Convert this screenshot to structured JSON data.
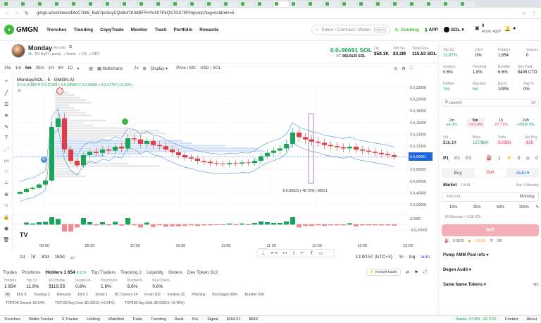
{
  "browser": {
    "tabs": [
      "",
      "",
      "",
      "",
      "",
      "",
      "",
      "",
      "",
      "",
      "",
      "",
      "",
      "",
      "",
      "",
      "",
      "",
      "",
      "",
      "",
      "",
      "",
      "",
      "",
      "",
      "",
      ""
    ],
    "url": "gmgn.ai/sol/token/DtoC7kb5_Ba97psSuyCQxBuf7K3dBFFHYvXhTPkQSTDS7RPmpump?tag=kol&min=5"
  },
  "app": {
    "brand": "GMGN",
    "nav": [
      "Trenches",
      "Trending",
      "CopyTrade",
      "Monitor",
      "Track",
      "Portfolio",
      "Rewards"
    ],
    "search_placeholder": "Token / Contract / Wallet",
    "search_kbd": "Ctrl+K",
    "cooking": "Cooking",
    "app_label": "APP",
    "chain": "SOL",
    "balance": "0",
    "wallet": "Acom..4gcP"
  },
  "token": {
    "name": "Monday",
    "alt_name": "Monday",
    "age": "4h",
    "ca_short": "DS Ba97...pump",
    "meta": [
      "Name",
      "CA",
      "DEV"
    ],
    "price": "0.0₂96691 SOL",
    "mc_label": "MC",
    "mc": "966.9125 SOL",
    "liq_label": "Liq",
    "liq": "$58.1K",
    "vol_label": "24h Vol",
    "vol": "$3.2M",
    "fees_label": "Total Fees",
    "fees": "115.63 SOL"
  },
  "chart_tools": {
    "intervals": [
      "15s",
      "1m",
      "5m",
      "30m",
      "1H",
      "4H",
      "1D"
    ],
    "multicharts": "Multicharts",
    "display": "Display",
    "price_mc": "Price / MC",
    "usd_sol": "USD / SOL"
  },
  "chart_data": {
    "type": "candlestick",
    "title": "Monday/SOL · 5 · GMGN.AI",
    "ohlc_line": "O 0.0₃91855  H 0.0₃97389  L 0.0₃89589  C 0.0₂96681 +0.0₃47767 (+5.20%)",
    "indicator_value": "6",
    "y_ticks": [
      "0.0₂22000",
      "0.0₂20000",
      "0.0₂18000",
      "0.0₂16000",
      "0.0₂14000",
      "0.0₂12000",
      "0.0₂10000",
      "0.0₃80000",
      "0.0₃60000",
      "0.0₃40000",
      "0.0₃20000",
      "0.0000",
      "-0.0₃20000"
    ],
    "x_ticks": [
      "09:00",
      "09:30",
      "10:00",
      "10:30",
      "11:00",
      "11:30",
      "12:00",
      "12:30",
      "13:00"
    ],
    "y_range": [
      -0.0002,
      0.0024
    ],
    "last_price_tag": "0.0₂96681",
    "measure_label": "-0.0₃89021 (-48.72%) -89021",
    "closes": [
      0.00035,
      0.0004,
      0.00042,
      0.00048,
      0.00055,
      0.0015,
      0.00165,
      0.0011,
      0.0009,
      0.00082,
      0.001,
      0.00106,
      0.00104,
      0.0011,
      0.00108,
      0.00115,
      0.00112,
      0.0013,
      0.00128,
      0.0012,
      0.00125,
      0.00118,
      0.00116,
      0.0011,
      0.00105,
      0.001,
      0.00096,
      0.00094,
      0.0009,
      0.00088,
      0.00086,
      0.00085,
      0.00084,
      0.00086,
      0.00085,
      0.00087,
      0.00086,
      0.0009,
      0.00098,
      0.00104,
      0.00108,
      0.00112,
      0.0012,
      0.0014,
      0.00132,
      0.00128,
      0.00124,
      0.00122,
      0.00118,
      0.00116,
      0.00114,
      0.00112,
      0.00115,
      0.0011,
      0.00108,
      0.00106,
      0.00104,
      0.00102,
      0.001,
      0.00097
    ]
  },
  "bottom_tools": {
    "ranges": [
      "1d",
      "7d",
      "30d",
      "180d"
    ],
    "time": "13:00:57 (UTC+3)",
    "pct": "%",
    "log": "log",
    "auto": "auto"
  },
  "bottom_panel": {
    "tabs": [
      "Trades",
      "Positions",
      "Holders 1 654",
      "Top Traders",
      "Tracking 2",
      "Liquidity",
      "Orders",
      "Dev Token 312"
    ],
    "holders_badge": "8.61%",
    "instant_trade": "Instant trade",
    "stats": [
      {
        "label": "Holders",
        "value": "1 654"
      },
      {
        "label": "Top 10",
        "value": "11.9%"
      },
      {
        "label": "MC/Holder",
        "value": "$119.55"
      },
      {
        "label": "Insiders%",
        "value": "0.8%"
      },
      {
        "label": "Phishing%",
        "value": "1.8%"
      },
      {
        "label": "Bundler%",
        "value": "6.6%"
      },
      {
        "label": "BlueChip%",
        "value": "0.8%"
      }
    ],
    "filters": [
      "All",
      "KOL 8",
      "Tracking 2",
      "Remarks",
      "DEV 1",
      "Smart 1",
      "BC Owners 24",
      "Fresh 302",
      "Insiders 16",
      "Phishing",
      "Bot Degen 999+",
      "Bundler 566"
    ],
    "footer": [
      "TOP100 Owned: 65.54%",
      "TOP100 Avg Cost: $0.00019 (+5.24%)",
      "TOP100 Avg Sold: $0.00019 (+5.45%)"
    ]
  },
  "right_panel": {
    "row1": [
      {
        "label": "Top 10",
        "value": "11.87%"
      },
      {
        "label": "DEV",
        "value": "0%"
      },
      {
        "label": "Holders",
        "value": "1,654"
      },
      {
        "label": "Snipers",
        "value": "0"
      }
    ],
    "row2": [
      {
        "label": "Insiders",
        "value": "0.6%"
      },
      {
        "label": "Phishing",
        "value": "1.8%"
      },
      {
        "label": "Bundler",
        "value": "6.6%"
      },
      {
        "label": "Dex Paid",
        "value": "$499 CTO"
      }
    ],
    "row3": [
      {
        "label": "NoMint",
        "value": "Yes"
      },
      {
        "label": "Blacklist",
        "value": "No"
      },
      {
        "label": "Burnt",
        "value": "100%"
      },
      {
        "label": "Rug %",
        "value": "0%"
      }
    ],
    "launch_label": "Launch",
    "launch_count": "13",
    "timeframes": [
      {
        "label": "1m",
        "value": "+4.3%"
      },
      {
        "label": "5m",
        "value": "-10.14%"
      },
      {
        "label": "1h",
        "value": "-27.71%"
      },
      {
        "label": "24h",
        "value": "+3908.5%"
      }
    ],
    "vol": [
      {
        "label": "Vol",
        "value": "$16.1K"
      },
      {
        "label": "Buys",
        "value": "127/$8K"
      },
      {
        "label": "Sells",
        "value": "95/$8K"
      },
      {
        "label": "Net Buy",
        "value": "-$2K"
      }
    ],
    "presets": [
      "P1",
      "P2",
      "P3"
    ],
    "preset_counts": [
      "1",
      "0",
      "0"
    ],
    "buy": "Buy",
    "sell": "Sell",
    "auto": "Auto",
    "market": "Market",
    "limit": "Limit",
    "bal": "Bal: 0 Monday",
    "amount_placeholder": "Amount",
    "amount_unit": "Monday",
    "pcts": [
      "10%",
      "25%",
      "50%",
      "100%"
    ],
    "receive": "1M Monday ≈ 0.88 SOL",
    "sell_button": "Sell",
    "fee_a": "0.0015",
    "fee_b": "0.0035",
    "fee_c": "Off",
    "sections": [
      "Pump AMM Pool info",
      "Degen Audit",
      "Same Name Tokens"
    ],
    "same_mc": "MC"
  },
  "status_bar": {
    "items": [
      "Trenches",
      "Wallet Tracker",
      "X Tracker",
      "Holding",
      "Watchlist",
      "Trade",
      "Trending",
      "Rank",
      "PnL",
      "Signal",
      "$204.51",
      "$84K"
    ],
    "stable": "Stable: 27 MS · 60 FPS",
    "contact": "Contact",
    "about": "About"
  },
  "colors": {
    "accent": "#3fb93b",
    "up": "#1aa35a",
    "down": "#e23b4a"
  }
}
